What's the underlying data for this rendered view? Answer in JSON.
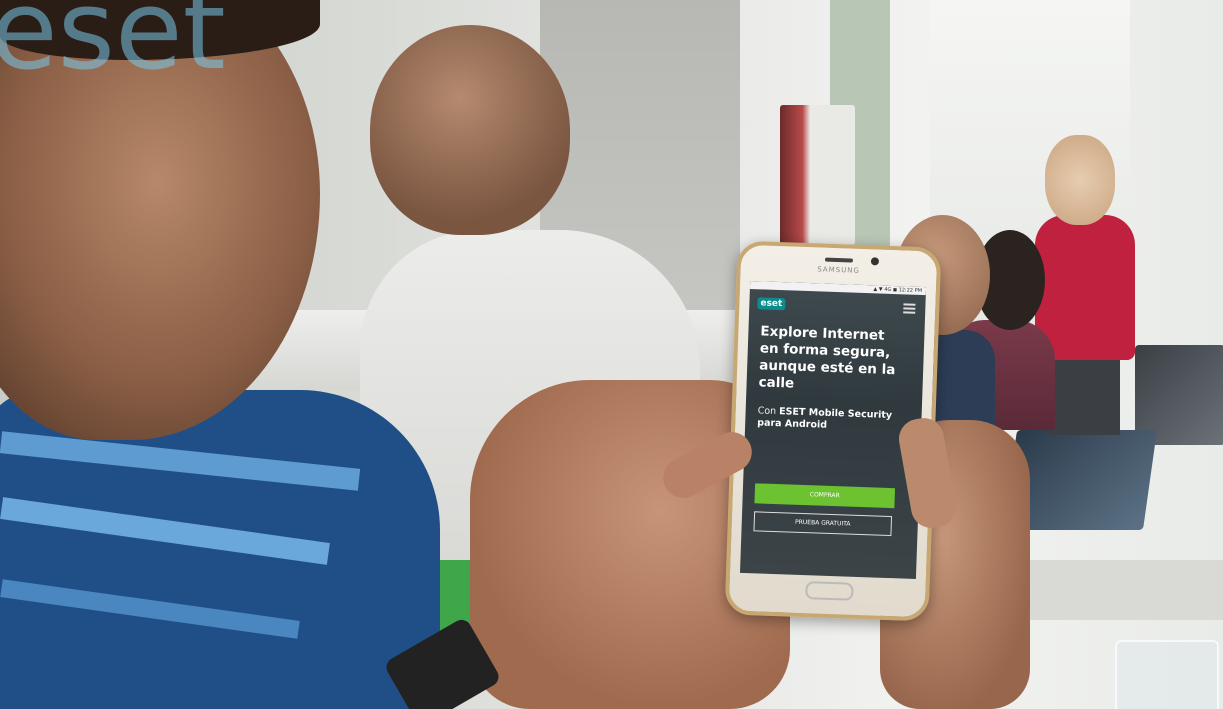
{
  "watermark_logo": "eset",
  "phone": {
    "brand": "SAMSUNG",
    "status_bar": "▲ ▼ 4G ◼ 12:22 PM",
    "site": {
      "logo": "eset",
      "menu_icon": "hamburger-menu-icon",
      "headline_lines": [
        "Explore Internet",
        "en forma segura,",
        "aunque esté en la",
        "calle"
      ],
      "sub_prefix": "Con ",
      "sub_strong": "ESET Mobile Security para Android",
      "buy_button": "COMPRAR",
      "trial_button": "PRUEBA GRATUITA"
    }
  },
  "colors": {
    "eset_teal": "#0d8c8c",
    "buy_green": "#6cc230",
    "phone_gold": "#c7a873",
    "shirt_blue": "#1f4f86"
  }
}
